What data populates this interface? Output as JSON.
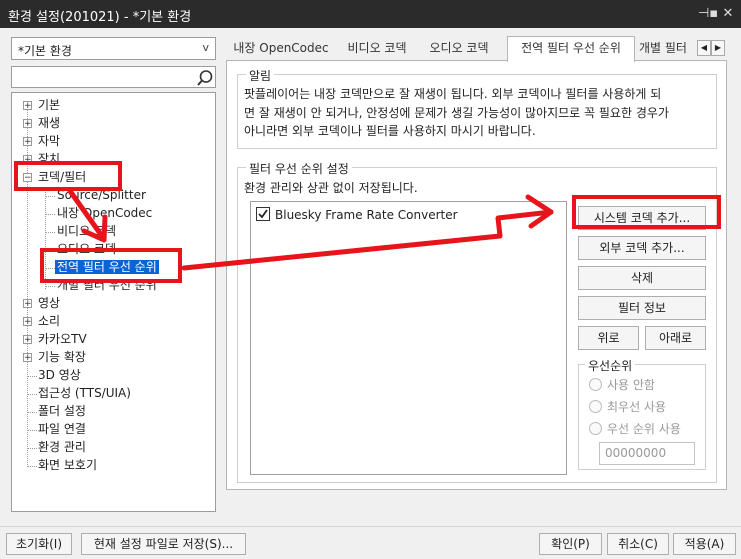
{
  "window": {
    "title": "환경 설정(201021) - *기본 환경",
    "pin_glyph": "⊣▪",
    "close_glyph": "✕"
  },
  "preset": {
    "value": "*기본 환경",
    "arrow": "v"
  },
  "search": {
    "value": ""
  },
  "tree": {
    "items": [
      {
        "label": "기본",
        "expander": "+"
      },
      {
        "label": "재생",
        "expander": "+"
      },
      {
        "label": "자막",
        "expander": "+"
      },
      {
        "label": "장치",
        "expander": "+"
      },
      {
        "label": "코덱/필터",
        "expander": "−"
      },
      {
        "label": "Source/Splitter"
      },
      {
        "label": "내장 OpenCodec"
      },
      {
        "label": "비디오 코덱"
      },
      {
        "label": "오디오 코덱"
      },
      {
        "label": "전역 필터 우선 순위"
      },
      {
        "label": "개별 필터 우선 순위"
      },
      {
        "label": "영상",
        "expander": "+"
      },
      {
        "label": "소리",
        "expander": "+"
      },
      {
        "label": "카카오TV",
        "expander": "+"
      },
      {
        "label": "기능 확장",
        "expander": "+"
      },
      {
        "label": "3D 영상"
      },
      {
        "label": "접근성 (TTS/UIA)"
      },
      {
        "label": "폴더 설정"
      },
      {
        "label": "파일 연결"
      },
      {
        "label": "환경 관리"
      },
      {
        "label": "화면 보호기"
      }
    ]
  },
  "tabs": [
    {
      "label": "내장 OpenCodec"
    },
    {
      "label": "비디오 코덱"
    },
    {
      "label": "오디오 코덱"
    },
    {
      "label": "전역 필터 우선 순위"
    },
    {
      "label": "개별 필터"
    }
  ],
  "tab_scroll": {
    "left": "◀",
    "right": "▶"
  },
  "notice": {
    "title": "알림",
    "lines": [
      "팟플레이어는 내장 코덱만으로 잘 재생이 됩니다. 외부 코덱이나 필터를 사용하게 되",
      "면 잘 재생이 안 되거나, 안정성에 문제가 생길 가능성이 많아지므로 꼭 필요한 경우가",
      "아니라면 외부 코덱이나 필터를 사용하지 마시기 바랍니다."
    ]
  },
  "filter_priority": {
    "title": "필터 우선 순위 설정",
    "subtitle": "환경 관리와 상관 없이 저장됩니다.",
    "list": [
      {
        "label": "Bluesky Frame Rate Converter",
        "checked": true
      }
    ],
    "buttons": {
      "add_system": "시스템 코덱 추가...",
      "add_external": "외부 코덱 추가...",
      "delete": "삭제",
      "filter_info": "필터 정보",
      "up": "위로",
      "down": "아래로"
    },
    "priority": {
      "title": "우선순위",
      "options": [
        "사용 안함",
        "최우선 사용",
        "우선 순위 사용"
      ],
      "value": "00000000"
    }
  },
  "bottom": {
    "reset": "초기화(I)",
    "save_to_file": "현재 설정 파일로 저장(S)...",
    "ok": "확인(P)",
    "cancel": "취소(C)",
    "apply": "적용(A)"
  },
  "colors": {
    "annotation_red": "#e8141b",
    "selection_blue": "#0a64d6",
    "titlebar": "#2b2b2b"
  }
}
